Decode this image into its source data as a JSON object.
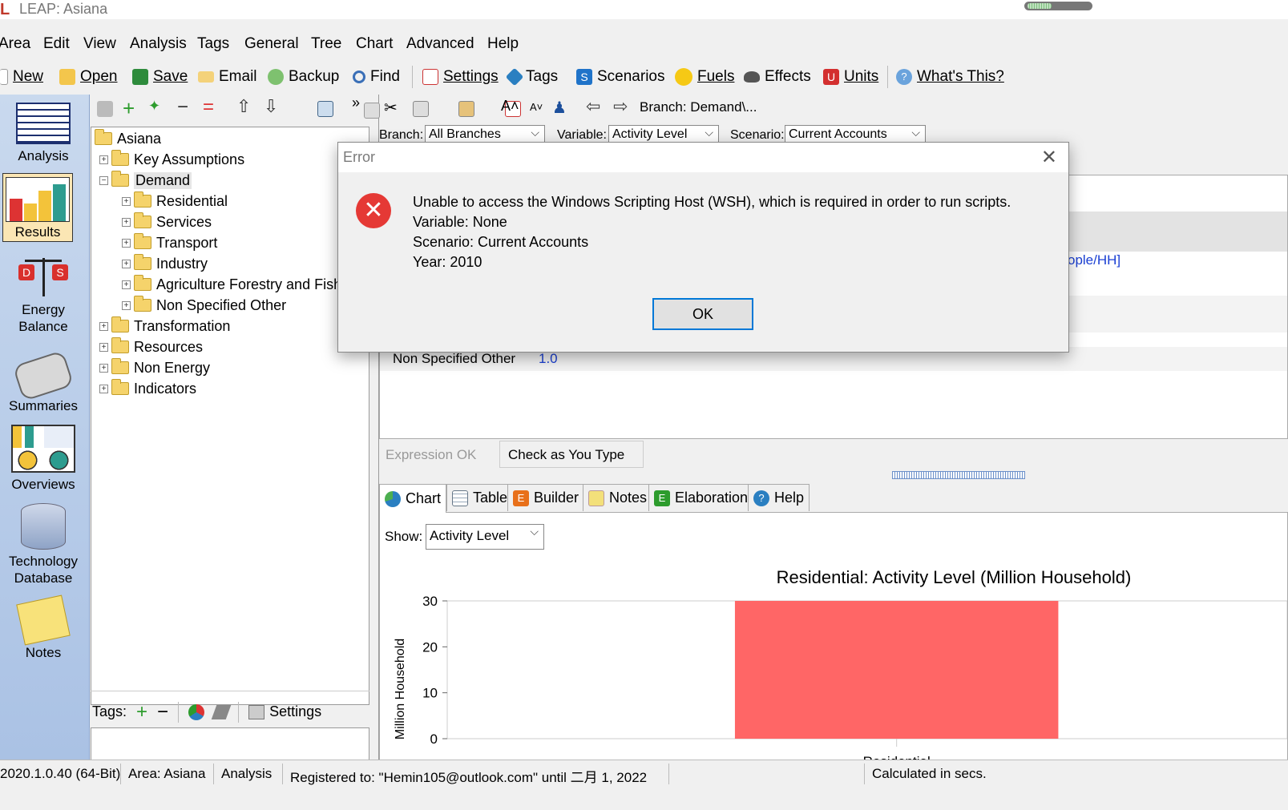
{
  "window": {
    "title": "LEAP: Asiana"
  },
  "menu": [
    "Area",
    "Edit",
    "View",
    "Analysis",
    "Tags",
    "General",
    "Tree",
    "Chart",
    "Advanced",
    "Help"
  ],
  "toolbar": {
    "new": "New",
    "open": "Open",
    "save": "Save",
    "email": "Email",
    "backup": "Backup",
    "find": "Find",
    "settings": "Settings",
    "tags": "Tags",
    "scenarios": "Scenarios",
    "fuels": "Fuels",
    "effects": "Effects",
    "units": "Units",
    "whats_this": "What's This?"
  },
  "leftnav": {
    "analysis": "Analysis",
    "results": "Results",
    "energy_balance_1": "Energy",
    "energy_balance_2": "Balance",
    "summaries": "Summaries",
    "overviews": "Overviews",
    "tech_db_1": "Technology",
    "tech_db_2": "Database",
    "notes": "Notes"
  },
  "tree": {
    "root": "Asiana",
    "items": [
      {
        "label": "Key Assumptions"
      },
      {
        "label": "Demand"
      },
      {
        "label": "Residential"
      },
      {
        "label": "Services"
      },
      {
        "label": "Transport"
      },
      {
        "label": "Industry"
      },
      {
        "label": "Agriculture Forestry and Fish"
      },
      {
        "label": "Non Specified Other"
      },
      {
        "label": "Transformation"
      },
      {
        "label": "Resources"
      },
      {
        "label": "Non Energy"
      },
      {
        "label": "Indicators"
      }
    ]
  },
  "tags_panel": {
    "label": "Tags:",
    "settings": "Settings"
  },
  "editor_toolbar": {
    "branch_path": "Branch: Demand\\..."
  },
  "filters": {
    "branch_label": "Branch:",
    "branch_value": "All Branches",
    "variable_label": "Variable:",
    "variable_value": "Activity Level",
    "scenario_label": "Scenario:",
    "scenario_value": "Current Accounts"
  },
  "editor": {
    "unit_fragment": "ople/HH]",
    "row_label": "Non Specified Other",
    "row_value": "1.0"
  },
  "expression": {
    "status": "Expression OK",
    "check_as_you_type": "Check as You Type"
  },
  "tabs": [
    "Chart",
    "Table",
    "Builder",
    "Notes",
    "Elaboration",
    "Help"
  ],
  "chart_controls": {
    "show_label": "Show:",
    "show_value": "Activity Level"
  },
  "chart_data": {
    "type": "bar",
    "title": "Residential: Activity Level (Million Household)",
    "ylabel": "Million Household",
    "xlabel": "",
    "categories": [
      "Residential"
    ],
    "values": [
      30
    ],
    "ylim": [
      0,
      30
    ],
    "yticks": [
      0,
      10,
      20,
      30
    ],
    "bar_color": "#ff6666"
  },
  "status": {
    "version": "2020.1.0.40 (64-Bit)",
    "area": "Area: Asiana",
    "mode": "Analysis",
    "registered": "Registered to: \"Hemin105@outlook.com\" until 二月 1, 2022",
    "calculated": "Calculated in  secs."
  },
  "dialog": {
    "title": "Error",
    "line1": "Unable to access the Windows Scripting Host (WSH), which is required in order to run scripts.",
    "line2": "Variable: None",
    "line3": "Scenario: Current Accounts",
    "line4": "Year: 2010",
    "ok": "OK"
  }
}
